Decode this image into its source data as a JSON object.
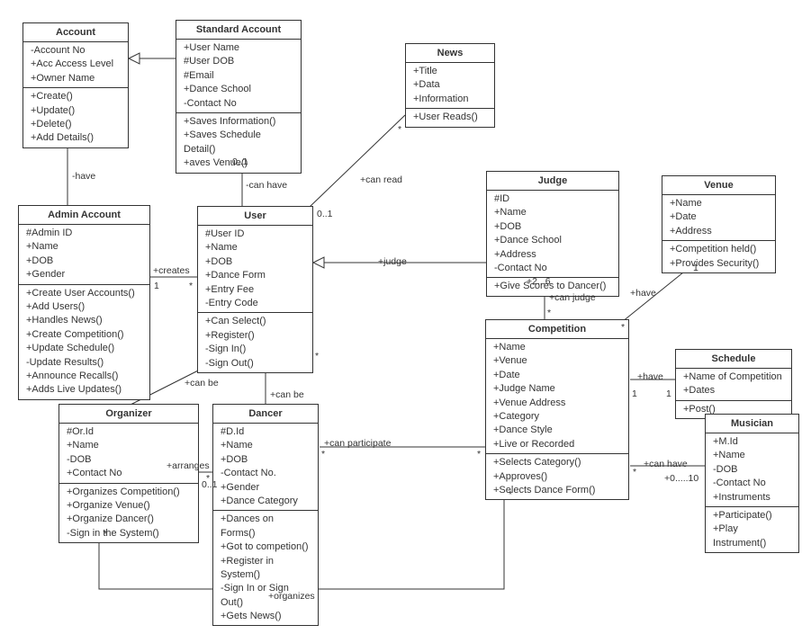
{
  "classes": {
    "account": {
      "name": "Account",
      "attrs": [
        "-Account No",
        "+Acc Access Level",
        "+Owner Name"
      ],
      "ops": [
        "+Create()",
        "+Update()",
        "+Delete()",
        "+Add Details()"
      ]
    },
    "standardAccount": {
      "name": "Standard Account",
      "attrs": [
        "+User Name",
        "#User DOB",
        "#Email",
        "+Dance School",
        "-Contact No"
      ],
      "ops": [
        "+Saves Information()",
        "+Saves Schedule Detail()",
        "+aves Venue()"
      ]
    },
    "news": {
      "name": "News",
      "attrs": [
        "+Title",
        "+Data",
        "+Information"
      ],
      "ops": [
        "+User Reads()"
      ]
    },
    "adminAccount": {
      "name": "Admin Account",
      "attrs": [
        "#Admin ID",
        "+Name",
        "+DOB",
        "+Gender"
      ],
      "ops": [
        "+Create User Accounts()",
        "+Add Users()",
        "+Handles News()",
        "+Create Competition()",
        "+Update Schedule()",
        "-Update Results()",
        "+Announce Recalls()",
        "+Adds Live Updates()"
      ]
    },
    "user": {
      "name": "User",
      "attrs": [
        "#User ID",
        "+Name",
        "+DOB",
        "+Dance Form",
        "+Entry Fee",
        "-Entry Code"
      ],
      "ops": [
        "+Can Select()",
        "+Register()",
        "-Sign In()",
        "-Sign Out()"
      ]
    },
    "judge": {
      "name": "Judge",
      "attrs": [
        "#ID",
        "+Name",
        "+DOB",
        "+Dance School",
        "+Address",
        "-Contact No"
      ],
      "ops": [
        "+Give Scores to Dancer()"
      ]
    },
    "venue": {
      "name": "Venue",
      "attrs": [
        "+Name",
        "+Date",
        "+Address"
      ],
      "ops": [
        "+Competition held()",
        "+Provides Security()"
      ]
    },
    "competition": {
      "name": "Competition",
      "attrs": [
        "+Name",
        "+Venue",
        "+Date",
        "+Judge Name",
        "+Venue Address",
        "+Category",
        "+Dance Style",
        "+Live or Recorded"
      ],
      "ops": [
        "+Selects Category()",
        "+Approves()",
        "+Selects Dance Form()"
      ]
    },
    "schedule": {
      "name": "Schedule",
      "attrs": [
        "+Name of Competition",
        "+Dates"
      ],
      "ops": [
        "+Post()"
      ]
    },
    "organizer": {
      "name": "Organizer",
      "attrs": [
        "#Or.Id",
        "+Name",
        "-DOB",
        "+Contact No"
      ],
      "ops": [
        "+Organizes Competition()",
        "+Organize Venue()",
        "+Organize Dancer()",
        "-Sign in the System()"
      ]
    },
    "dancer": {
      "name": "Dancer",
      "attrs": [
        "#D.Id",
        "+Name",
        "+DOB",
        "-Contact No.",
        "+Gender",
        "+Dance Category"
      ],
      "ops": [
        "+Dances on Forms()",
        "+Got to competion()",
        "+Register in System()",
        "-Sign In or Sign Out()",
        "+Gets News()"
      ]
    },
    "musician": {
      "name": "Musician",
      "attrs": [
        "+M.Id",
        "+Name",
        "-DOB",
        "-Contact No",
        "+Instruments"
      ],
      "ops": [
        "+Participate()",
        "+Play Instrument()"
      ]
    }
  },
  "labels": {
    "have1": "-have",
    "canHave1": "-can have",
    "canRead": "+can read",
    "creates": "+creates",
    "judge": "+judge",
    "canJudge": "+can judge",
    "haveVenue": "+have",
    "haveSched": "+have",
    "canBe1": "+can be",
    "canBe2": "+can be",
    "arranges": "+arranges",
    "canParticipate": "+can participate",
    "canHave2": "+can have",
    "organizes": "+organizes",
    "m01a": "0..1",
    "m01b": "0..1",
    "m26": "+2...6",
    "one1": "1",
    "one2": "1",
    "one3": "1",
    "one4": "1",
    "star1": "*",
    "star2": "*",
    "star3": "*",
    "star4": "*",
    "star5": "*",
    "star6": "*",
    "star7": "*",
    "star8": "*",
    "star9": "*",
    "star10": "*",
    "m010": "+0.....10",
    "m01c": "0..1",
    "star11": "*"
  }
}
